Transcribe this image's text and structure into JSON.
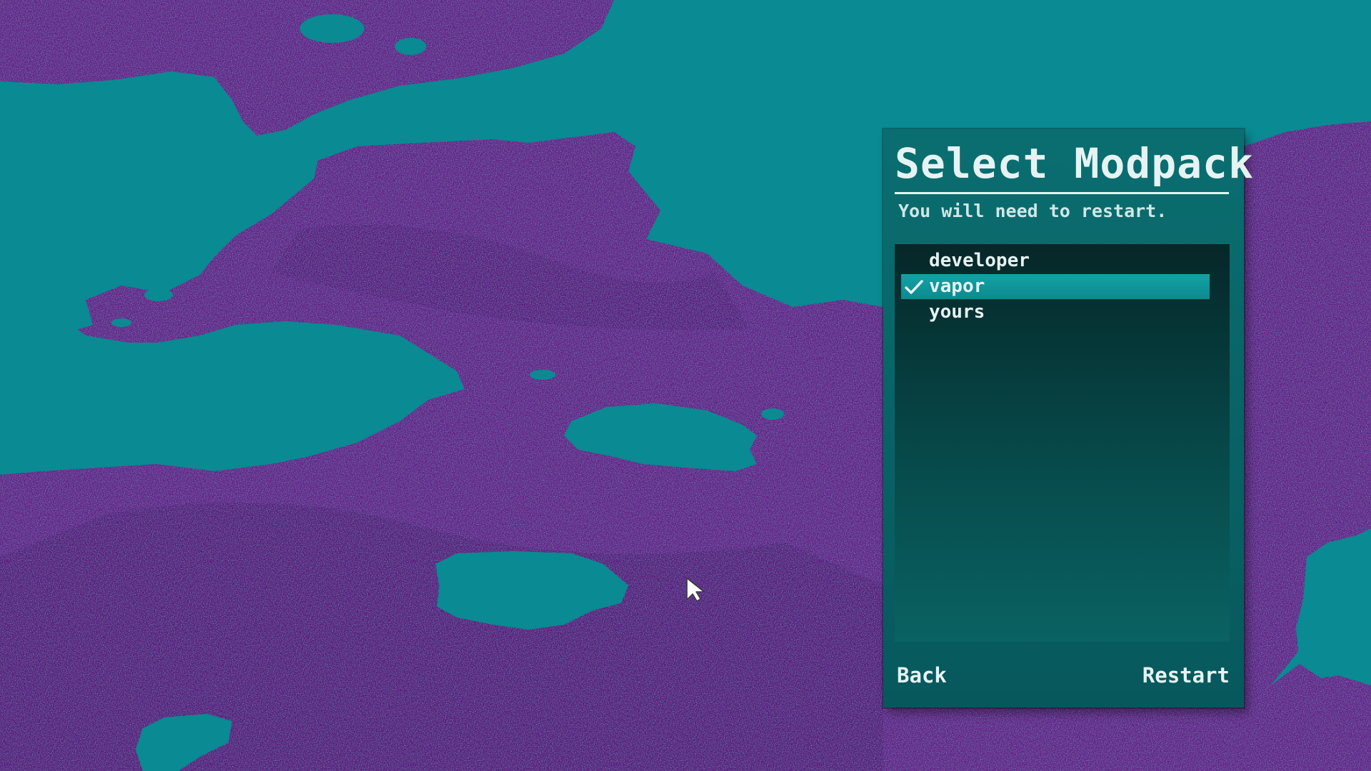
{
  "colors": {
    "water": "#0a8a92",
    "land": "#6b1a8c",
    "land_dark": "#4e1570",
    "panel": "#0a6e70",
    "highlight": "#13a2a6",
    "text": "#e6f3f3"
  },
  "dialog": {
    "title": "Select Modpack",
    "subtitle": "You will need to restart.",
    "items": [
      {
        "label": "developer",
        "selected": false
      },
      {
        "label": "vapor",
        "selected": true,
        "icon": "checkmark-icon"
      },
      {
        "label": "yours",
        "selected": false
      }
    ],
    "back_label": "Back",
    "restart_label": "Restart"
  },
  "cursor": {
    "icon": "mouse-pointer-icon"
  }
}
